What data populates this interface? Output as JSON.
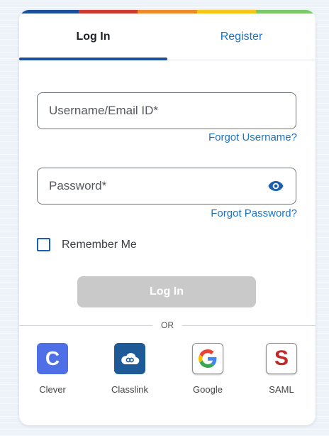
{
  "colors": {
    "stripe": [
      "#1c4f9c",
      "#d0392f",
      "#ef8a2b",
      "#f5c518",
      "#7cc96b"
    ],
    "accent": "#1a73c9",
    "disabled_button": "#c9c9c9"
  },
  "tabs": [
    {
      "label": "Log In",
      "active": true
    },
    {
      "label": "Register",
      "active": false
    }
  ],
  "form": {
    "username_placeholder": "Username/Email ID*",
    "username_value": "",
    "password_placeholder": "Password*",
    "password_value": "",
    "forgot_username": "Forgot Username?",
    "forgot_password": "Forgot Password?",
    "remember_me": "Remember Me",
    "remember_checked": false,
    "login_button": "Log In",
    "login_button_enabled": false,
    "password_visibility_icon": "eye-icon"
  },
  "divider": {
    "text": "OR"
  },
  "sso": [
    {
      "label": "Clever",
      "icon": "clever-icon",
      "glyph": "C"
    },
    {
      "label": "Classlink",
      "icon": "classlink-icon"
    },
    {
      "label": "Google",
      "icon": "google-icon"
    },
    {
      "label": "SAML",
      "icon": "saml-icon",
      "glyph": "S"
    }
  ]
}
